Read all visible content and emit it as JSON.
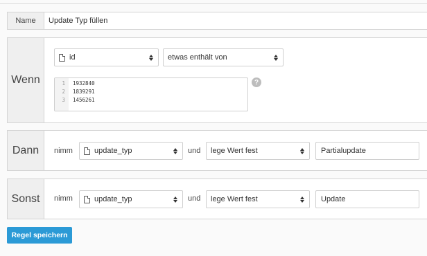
{
  "name_row": {
    "label": "Name",
    "value": "Update Typ füllen"
  },
  "wenn": {
    "label": "Wenn",
    "field_select": "id",
    "operator_select": "etwas enthält von",
    "editor_lines": [
      {
        "num": "1",
        "text": "1932840"
      },
      {
        "num": "2",
        "text": "1839291"
      },
      {
        "num": "3",
        "text": "1456261"
      }
    ],
    "help_icon": "?"
  },
  "dann": {
    "label": "Dann",
    "nimm_text": "nimm",
    "field_select": "update_typ",
    "und_text": "und",
    "action_select": "lege Wert fest",
    "value": "Partialupdate"
  },
  "sonst": {
    "label": "Sonst",
    "nimm_text": "nimm",
    "field_select": "update_typ",
    "und_text": "und",
    "action_select": "lege Wert fest",
    "value": "Update"
  },
  "save_button": "Regel speichern",
  "colors": {
    "accent": "#2b9ad6",
    "label_bg": "#efefef",
    "border": "#d4d4d4"
  }
}
